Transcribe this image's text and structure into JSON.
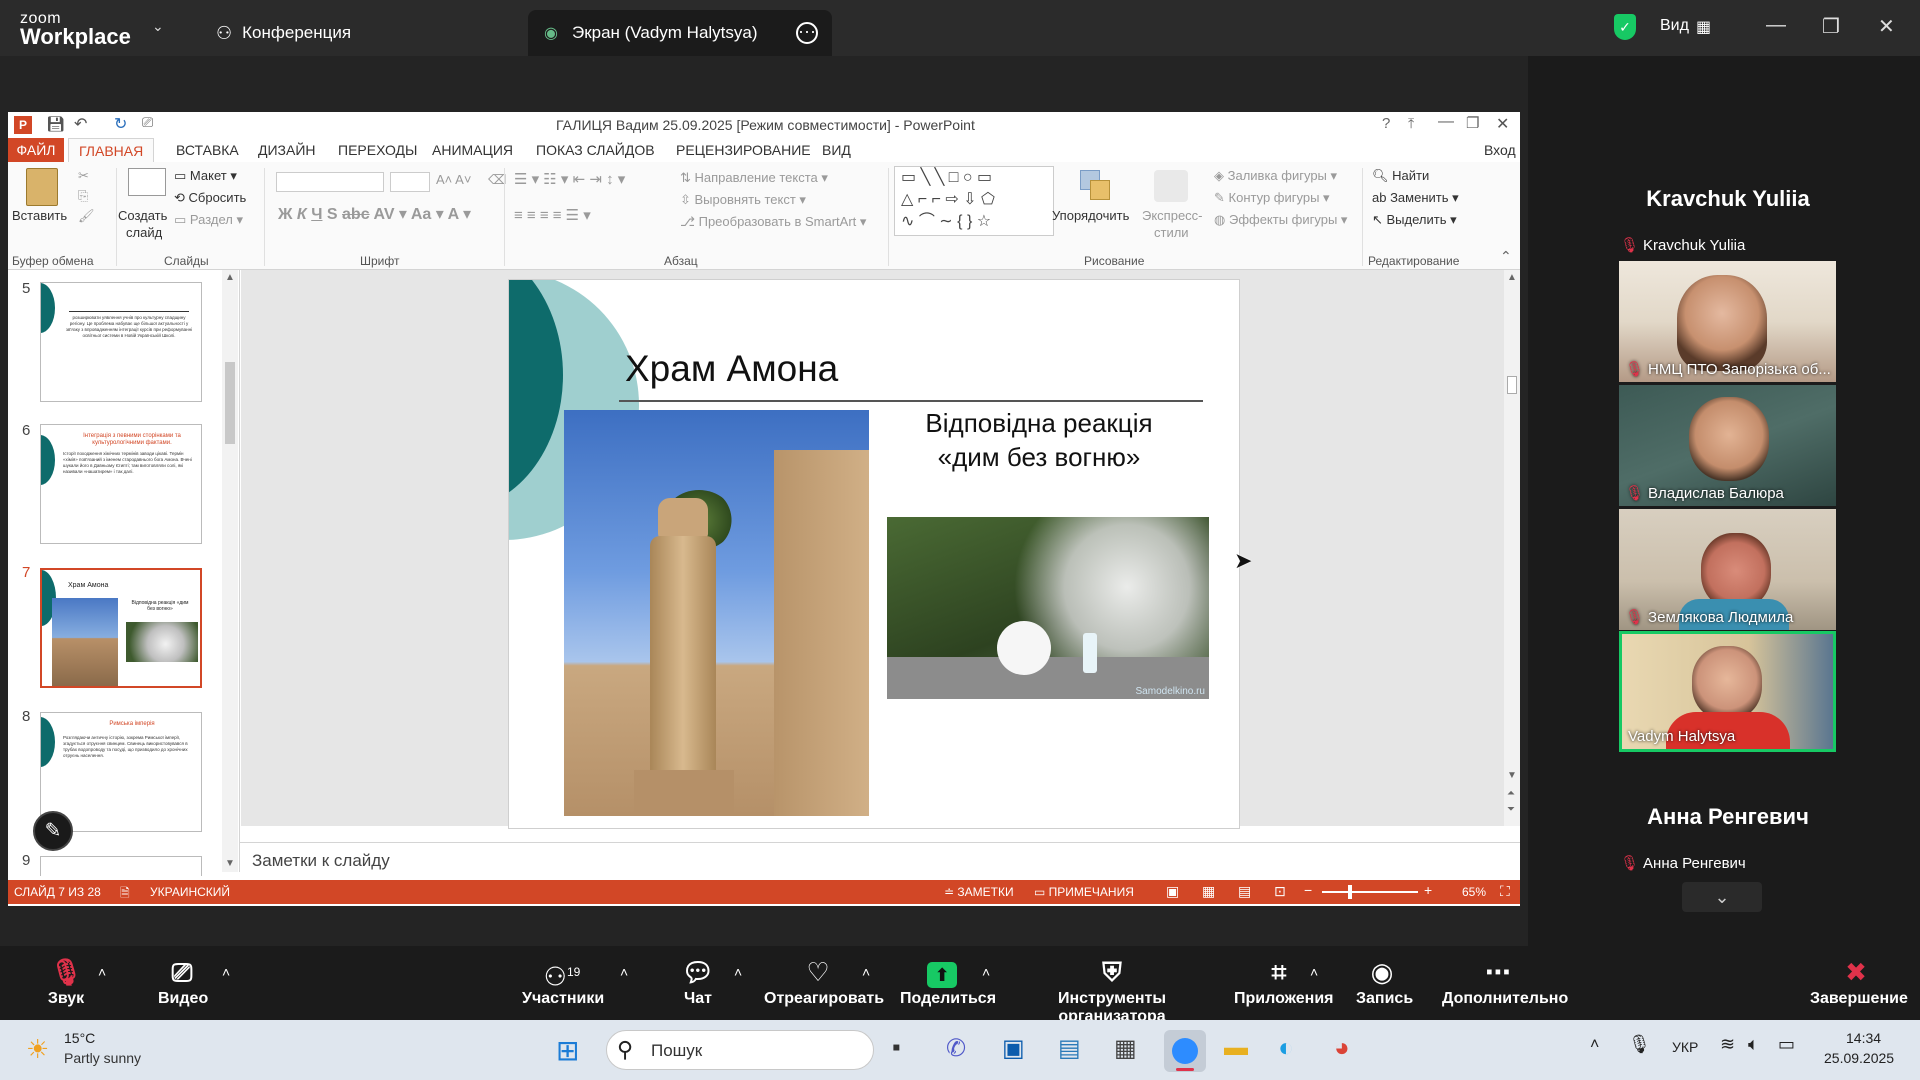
{
  "zoom": {
    "logo_small": "zoom",
    "logo_big": "Workplace",
    "tab_conference": "Конференция",
    "tab_screen": "Экран (Vadym Halytsya)",
    "view_label": "Вид"
  },
  "ppt": {
    "window_title": "ГАЛИЦЯ Вадим 25.09.2025 [Режим совместимости] - PowerPoint",
    "help": "?",
    "signin": "Вход",
    "tabs": [
      "ФАЙЛ",
      "ГЛАВНАЯ",
      "ВСТАВКА",
      "ДИЗАЙН",
      "ПЕРЕХОДЫ",
      "АНИМАЦИЯ",
      "ПОКАЗ СЛАЙДОВ",
      "РЕЦЕНЗИРОВАНИЕ",
      "ВИД"
    ],
    "ribbon": {
      "paste": "Вставить",
      "clipboard_group": "Буфер обмена",
      "create_slide": "Создать",
      "create_slide2": "слайд",
      "layout": "Макет",
      "reset": "Сбросить",
      "section": "Раздел",
      "slides_group": "Слайды",
      "font_group": "Шрифт",
      "text_direction": "Направление текста",
      "align_text": "Выровнять текст",
      "smartart": "Преобразовать в SmartArt",
      "paragraph_group": "Абзац",
      "arrange": "Упорядочить",
      "quick_styles": "Экспресс-",
      "quick_styles2": "стили",
      "shape_fill": "Заливка фигуры",
      "shape_outline": "Контур фигуры",
      "shape_effects": "Эффекты фигуры",
      "drawing_group": "Рисование",
      "find": "Найти",
      "replace": "Заменить",
      "select": "Выделить",
      "editing_group": "Редактирование"
    },
    "thumbnails": [
      {
        "num": "5",
        "text": "розширювати уявлення учнів про культурну спадщину регіону. Це проблема набуває ще більшої актуальності у зв'язку з впровадженням інтеграції курсів при реформуванні освітньої системи в Новій Українській Школі."
      },
      {
        "num": "6",
        "title": "Інтеграція з певними сторінками та культурологічними фактами.",
        "text": "Історії походження хімічних термінів заводи цікаві. Термін «хімія» пов'язаний з іменем стародавнього бога Амона. Вчені шукали його в Давньому Єгипті; там виготовляли солі, які називали «нашатирем» і так далі."
      },
      {
        "num": "7",
        "title": "Храм Амона",
        "text": "Відповідна реакція «дим без вогню»"
      },
      {
        "num": "8",
        "title": "Римська імперія",
        "text": "Розглядаючи античну історію, зокрема Римської імперії, згадується отруєння свинцем. Свинець використовувався в трубах водопроводу та посуді, що призводило до хронічних отруєнь населення."
      },
      {
        "num": "9"
      }
    ],
    "slide": {
      "title": "Храм Амона",
      "caption_line1": "Відповідна реакція",
      "caption_line2": "«дим без вогню»",
      "watermark": "Samodelkino.ru"
    },
    "notes_placeholder": "Заметки к слайду",
    "status": {
      "slide_of": "СЛАЙД 7 ИЗ 28",
      "language": "УКРАИНСКИЙ",
      "notes": "ЗАМЕТКИ",
      "comments": "ПРИМЕЧАНИЯ",
      "zoom": "65%"
    }
  },
  "panel": {
    "top_name": "Kravchuk Yuliia",
    "top_label": "Kravchuk Yuliia",
    "tiles": [
      {
        "label": "НМЦ ПТО Запорізька об..."
      },
      {
        "label": "Владислав Балюра"
      },
      {
        "label": "Землякова Людмила"
      },
      {
        "label": "Vadym Halytsya"
      }
    ],
    "bottom_name": "Анна Ренгевич",
    "bottom_label": "Анна Ренгевич"
  },
  "toolbar": {
    "audio": "Звук",
    "video": "Видео",
    "participants": "Участники",
    "participants_count": "19",
    "chat": "Чат",
    "react": "Отреагировать",
    "share": "Поделиться",
    "host_tools": "Инструменты организатора",
    "apps": "Приложения",
    "record": "Запись",
    "more": "Дополнительно",
    "end": "Завершение"
  },
  "taskbar": {
    "temp": "15°C",
    "weather": "Partly sunny",
    "search": "Пошук",
    "lang": "УКР",
    "time": "14:34",
    "date": "25.09.2025"
  },
  "colors": {
    "ppt_accent": "#d24726",
    "teal": "#0e6b6b",
    "zoom_green": "#17c964",
    "end_red": "#e0324a"
  }
}
